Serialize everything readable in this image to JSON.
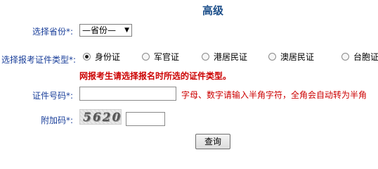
{
  "page": {
    "title": "高级"
  },
  "form": {
    "province": {
      "label": "选择省份",
      "required_mark": "*:",
      "selected": "—省份—"
    },
    "cert_type": {
      "label": "选择报考证件类型",
      "required_mark": "*:",
      "options": [
        {
          "label": "身份证",
          "checked": true
        },
        {
          "label": "军官证",
          "checked": false
        },
        {
          "label": "港居民证",
          "checked": false
        },
        {
          "label": "澳居民证",
          "checked": false
        },
        {
          "label": "台胞证",
          "checked": false
        }
      ],
      "notice": "网报考生请选择报名时所选的证件类型。"
    },
    "cert_number": {
      "label": "证件号码",
      "required_mark": "*:",
      "value": "",
      "hint": "字母、数字请输入半角字符，全角会自动转为半角"
    },
    "captcha": {
      "label": "附加码",
      "required_mark": "*:",
      "image_text": "5620",
      "value": ""
    },
    "submit_label": "查询"
  }
}
